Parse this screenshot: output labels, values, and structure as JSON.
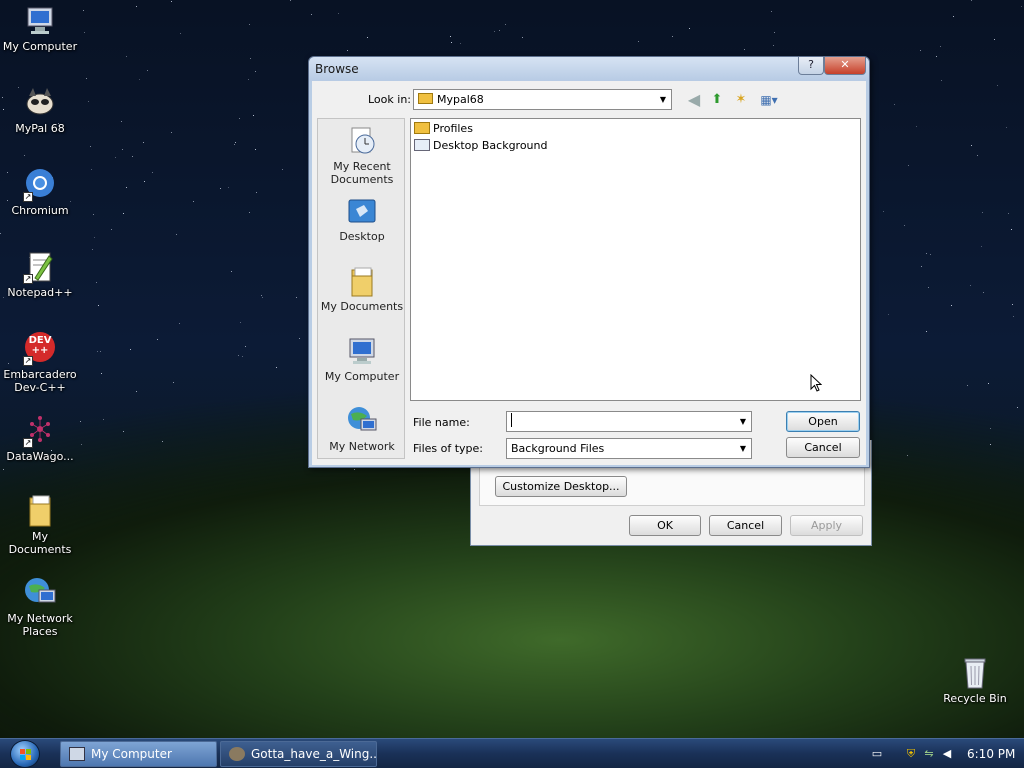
{
  "desktop": {
    "icons": [
      {
        "label": "My Computer",
        "icon": "my-computer-icon"
      },
      {
        "label": "MyPal 68",
        "icon": "mypal-icon"
      },
      {
        "label": "Chromium",
        "icon": "chromium-icon"
      },
      {
        "label": "Notepad++",
        "icon": "notepad-plus-plus-icon"
      },
      {
        "label": "Embarcadero Dev-C++",
        "icon": "dev-cpp-icon",
        "badge": "DEV ++"
      },
      {
        "label": "DataWago...",
        "icon": "datawagon-icon"
      },
      {
        "label": "My Documents",
        "icon": "my-documents-icon"
      },
      {
        "label": "My Network Places",
        "icon": "network-places-icon"
      },
      {
        "label": "Recycle Bin",
        "icon": "recycle-bin-icon"
      }
    ]
  },
  "display_dialog": {
    "customize_label": "Customize Desktop...",
    "ok_label": "OK",
    "cancel_label": "Cancel",
    "apply_label": "Apply"
  },
  "browse_dialog": {
    "title": "Browse",
    "help_glyph": "?",
    "close_glyph": "✕",
    "look_in_label": "Look in:",
    "look_in_value": "Mypal68",
    "places": [
      {
        "label": "My Recent Documents",
        "icon": "recent-documents-icon"
      },
      {
        "label": "Desktop",
        "icon": "desktop-icon"
      },
      {
        "label": "My Documents",
        "icon": "my-documents-icon"
      },
      {
        "label": "My Computer",
        "icon": "my-computer-icon"
      },
      {
        "label": "My Network",
        "icon": "network-icon"
      }
    ],
    "files": [
      {
        "name": "Profiles",
        "icon": "folder-icon"
      },
      {
        "name": "Desktop Background",
        "icon": "shortcut-file-icon"
      }
    ],
    "file_name_label": "File name:",
    "file_name_value": "",
    "files_of_type_label": "Files of type:",
    "files_of_type_value": "Background Files",
    "open_label": "Open",
    "cancel_label": "Cancel"
  },
  "taskbar": {
    "tasks": [
      {
        "label": "My Computer",
        "active": true
      },
      {
        "label": "Gotta_have_a_Wing...",
        "active": false
      }
    ],
    "clock": "6:10 PM"
  },
  "colors": {
    "taskbar": "#1a3158",
    "dialog_title": "#b7cbe4",
    "close_button": "#c6402a"
  }
}
